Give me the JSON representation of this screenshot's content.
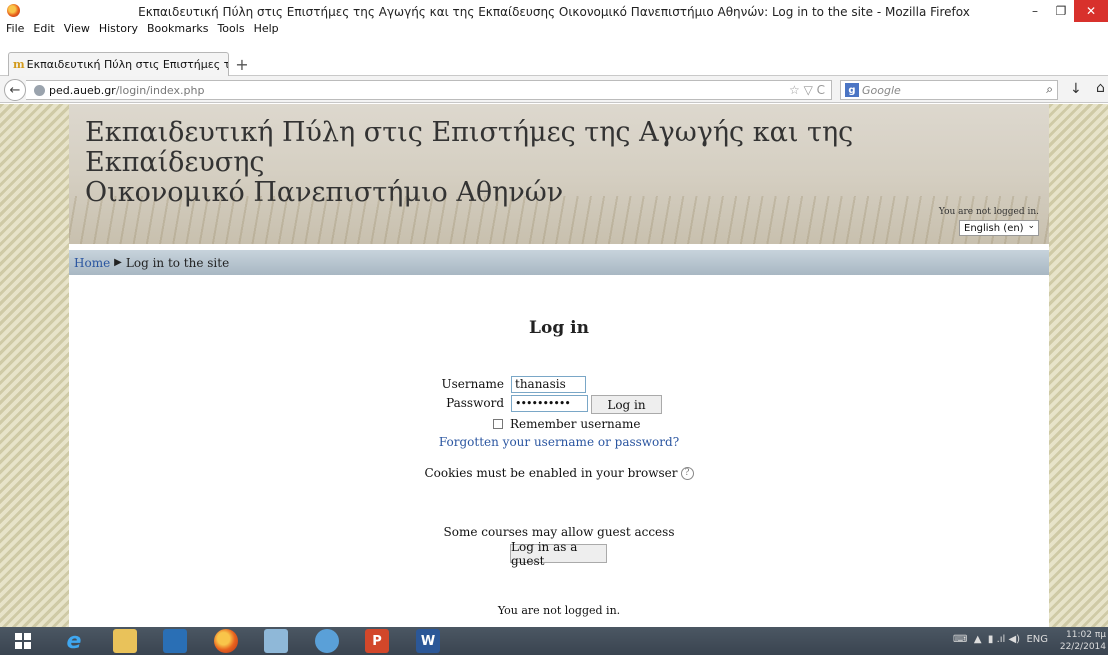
{
  "window": {
    "title": "Εκπαιδευτική Πύλη στις Επιστήμες της Αγωγής και της Εκπαίδευσης Οικονομικό Πανεπιστήμιο Αθηνών: Log in to the site - Mozilla Firefox",
    "minimize": "–",
    "maximize": "❐",
    "close": "✕"
  },
  "menu": [
    "File",
    "Edit",
    "View",
    "History",
    "Bookmarks",
    "Tools",
    "Help"
  ],
  "tab": {
    "favicon": "m",
    "label": "Εκπαιδευτική Πύλη στις Επιστήμες της ...",
    "new_tab": "+"
  },
  "nav": {
    "back": "←",
    "url_host": "ped.aueb.gr",
    "url_path": "/login/index.php",
    "url_tools": "☆ ▽ C",
    "search_engine_icon": "g",
    "search_placeholder": "Google",
    "search_go": "⌕",
    "download": "↓",
    "home": "⌂"
  },
  "site": {
    "title_line1": "Εκπαιδευτική Πύλη στις Επιστήμες της Αγωγής και της Εκπαίδευσης",
    "title_line2": "Οικονομικό Πανεπιστήμιο Αθηνών",
    "login_status": "You are not logged in.",
    "language": "English (en)",
    "language_arrow": "⌄"
  },
  "breadcrumb": {
    "home": "Home",
    "separator": "▶",
    "current": "Log in to the site"
  },
  "login": {
    "heading": "Log in",
    "username_label": "Username",
    "username_value": "thanasis",
    "password_label": "Password",
    "password_value": "••••••••••",
    "login_button": "Log in",
    "remember_label": "Remember username",
    "forgot_link": "Forgotten your username or password?",
    "cookies_notice": "Cookies must be enabled in your browser",
    "help_icon": "?",
    "guest_notice": "Some courses may allow guest access",
    "guest_button": "Log in as a guest",
    "footer_status": "You are not logged in."
  },
  "taskbar": {
    "tray_lang": "ENG",
    "clock_time": "11:02 πμ",
    "clock_date": "22/2/2014"
  }
}
